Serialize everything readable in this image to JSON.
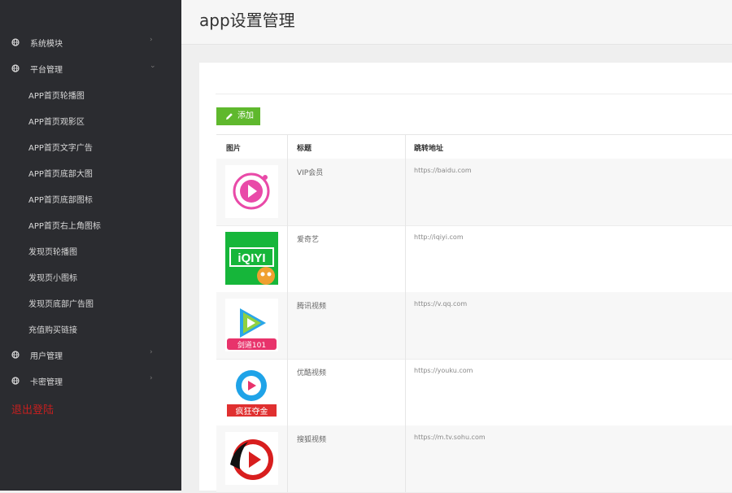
{
  "page_title": "app设置管理",
  "sidebar": {
    "groups": [
      {
        "label": "系统模块",
        "icon": "globe-icon",
        "chevron": "›"
      },
      {
        "label": "平台管理",
        "icon": "globe-icon",
        "chevron": "⌄"
      },
      {
        "label": "用户管理",
        "icon": "globe-icon",
        "chevron": "›"
      },
      {
        "label": "卡密管理",
        "icon": "globe-icon",
        "chevron": "›"
      }
    ],
    "subitems": [
      "APP首页轮播图",
      "APP首页观影区",
      "APP首页文字广告",
      "APP首页底部大图",
      "APP首页底部图标",
      "APP首页右上角图标",
      "发现页轮播图",
      "发现页小图标",
      "发现页底部广告图",
      "充值购买链接"
    ],
    "logout": "退出登陆"
  },
  "toolbar": {
    "add_label": "添加",
    "add_color": "#5fb82d"
  },
  "table": {
    "headers": [
      "图片",
      "标题",
      "跳转地址"
    ],
    "rows": [
      {
        "title": "VIP会员",
        "url": "https://baidu.com",
        "icon": "vip-play-icon"
      },
      {
        "title": "爱奇艺",
        "url": "http://iqiyi.com",
        "icon": "iqiyi-logo-icon",
        "logo_text": "iQIYI"
      },
      {
        "title": "腾讯视频",
        "url": "https://v.qq.com",
        "icon": "tencent-video-icon",
        "logo_text": "剑道101"
      },
      {
        "title": "优酷视频",
        "url": "https://youku.com",
        "icon": "youku-icon",
        "logo_text": "疯狂夺金"
      },
      {
        "title": "搜狐视频",
        "url": "https://m.tv.sohu.com",
        "icon": "sohu-video-icon"
      }
    ]
  },
  "colors": {
    "sidebar_bg": "#2b2c30",
    "logout": "#c51f1f",
    "accent_green": "#5fb82d"
  }
}
